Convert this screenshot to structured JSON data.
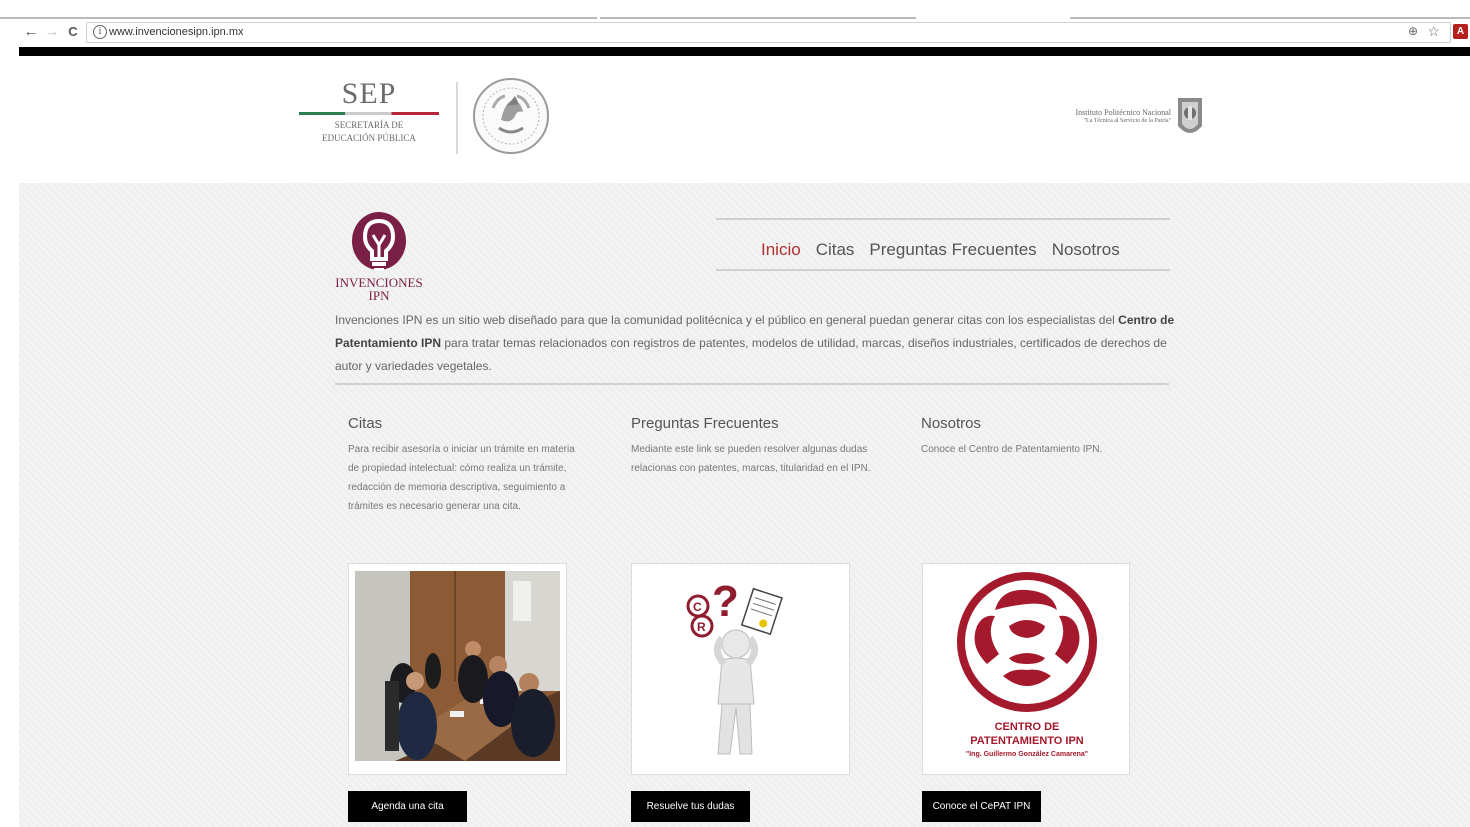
{
  "browser": {
    "url": "www.invencionesipn.ipn.mx",
    "back_icon": "←",
    "forward_icon": "→",
    "reload_icon": "C",
    "info_icon": "i",
    "zoom_icon": "⊕",
    "star_icon": "☆",
    "extension_icon_letter": "A"
  },
  "header": {
    "sep_title": "SEP",
    "sep_subtitle_line1": "SECRETARÍA DE",
    "sep_subtitle_line2": "EDUCACIÓN PÚBLICA",
    "ipn_line1": "Instituto Politécnico Nacional",
    "ipn_line2": "\"La Técnica al Servicio de la Patria\""
  },
  "logo": {
    "line1": "INVENCIONES",
    "line2": "IPN"
  },
  "nav": {
    "items": [
      "Inicio",
      "Citas",
      "Preguntas Frecuentes",
      "Nosotros"
    ],
    "active_index": 0
  },
  "intro": {
    "part1": "Invenciones IPN es un sitio web diseñado para que la comunidad politécnica y el público en general puedan generar citas con los especialistas del ",
    "bold": "Centro de Patentamiento IPN",
    "part2": " para tratar temas relacionados con registros de patentes, modelos de utilidad, marcas, diseños industriales, certificados de derechos de autor y variedades vegetales."
  },
  "sections": [
    {
      "title": "Citas",
      "text": "Para recibir asesoría o iniciar un trámite en materia de propiedad intelectual: cómo realiza un trámite, redacción de memoria descriptiva, seguimiento a trámites es necesario generar una cita.",
      "button": "Agenda una cita"
    },
    {
      "title": "Preguntas Frecuentes",
      "text": "Mediante este link se pueden resolver algunas dudas relacionas con patentes, marcas, titularidad en el IPN.",
      "button": "Resuelve tus dudas"
    },
    {
      "title": "Nosotros",
      "text": "Conoce el Centro de Patentamiento IPN.",
      "button": "Conoce el CePAT IPN"
    }
  ],
  "cepat_logo": {
    "line1": "CENTRO DE",
    "line2": "PATENTAMIENTO IPN",
    "line3": "\"Ing. Guillermo González Camarena\""
  },
  "colors": {
    "brand_maroon": "#7a1f45",
    "active_nav": "#b03030",
    "cepat_red": "#a4192c"
  }
}
